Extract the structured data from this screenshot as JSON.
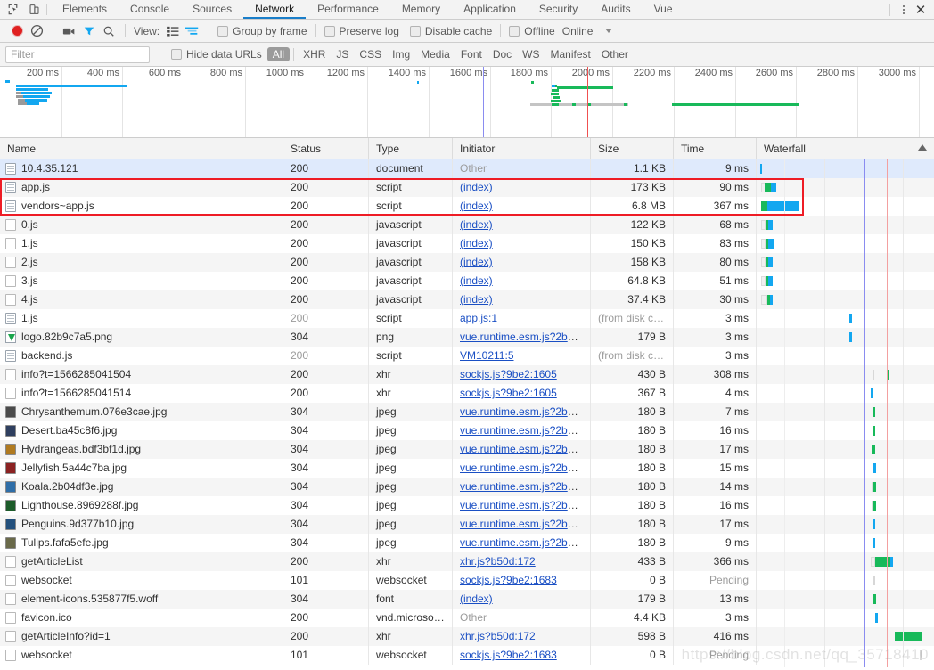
{
  "window": {
    "tabs": [
      {
        "label": "Elements",
        "active": false
      },
      {
        "label": "Console",
        "active": false
      },
      {
        "label": "Sources",
        "active": false
      },
      {
        "label": "Network",
        "active": true
      },
      {
        "label": "Performance",
        "active": false
      },
      {
        "label": "Memory",
        "active": false
      },
      {
        "label": "Application",
        "active": false
      },
      {
        "label": "Security",
        "active": false
      },
      {
        "label": "Audits",
        "active": false
      },
      {
        "label": "Vue",
        "active": false
      }
    ],
    "icons": {
      "inspect": "inspect-element-icon",
      "device": "device-toolbar-icon",
      "more": "more-options-icon",
      "close": "close-devtools-icon"
    }
  },
  "toolbar": {
    "record_label": "record-button",
    "clear_label": "clear-button",
    "capture_screenshots_label": "capture-screenshots-button",
    "filter_label": "filter-toggle-button",
    "search_label": "search-button",
    "view_label": "View:",
    "view_list_label": "list-view-button",
    "view_waterfall_label": "waterfall-view-button",
    "group_by_frame": "Group by frame",
    "preserve_log": "Preserve log",
    "disable_cache": "Disable cache",
    "offline": "Offline",
    "throttling": "Online"
  },
  "filter_bar": {
    "placeholder": "Filter",
    "value": "",
    "hide_data_urls": "Hide data URLs",
    "types": [
      "All",
      "XHR",
      "JS",
      "CSS",
      "Img",
      "Media",
      "Font",
      "Doc",
      "WS",
      "Manifest",
      "Other"
    ],
    "active_type": "All"
  },
  "overview": {
    "ticks": [
      "200 ms",
      "400 ms",
      "600 ms",
      "800 ms",
      "1000 ms",
      "1200 ms",
      "1400 ms",
      "1600 ms",
      "1800 ms",
      "2000 ms",
      "2200 ms",
      "2400 ms",
      "2600 ms",
      "2800 ms",
      "3000 ms"
    ]
  },
  "columns": [
    "Name",
    "Status",
    "Type",
    "Initiator",
    "Size",
    "Time",
    "Waterfall"
  ],
  "requests": [
    {
      "name": "10.4.35.121",
      "icon": "document-file-icon",
      "status": "200",
      "type": "document",
      "initiator": "Other",
      "initiator_link": false,
      "size": "1.1 KB",
      "time": "9 ms",
      "selected": true
    },
    {
      "name": "app.js",
      "icon": "script-file-icon",
      "status": "200",
      "type": "script",
      "initiator": "(index)",
      "initiator_link": true,
      "size": "173 KB",
      "time": "90 ms"
    },
    {
      "name": "vendors~app.js",
      "icon": "script-file-icon",
      "status": "200",
      "type": "script",
      "initiator": "(index)",
      "initiator_link": true,
      "size": "6.8 MB",
      "time": "367 ms"
    },
    {
      "name": "0.js",
      "icon": "generic-file-icon",
      "status": "200",
      "type": "javascript",
      "initiator": "(index)",
      "initiator_link": true,
      "size": "122 KB",
      "time": "68 ms"
    },
    {
      "name": "1.js",
      "icon": "generic-file-icon",
      "status": "200",
      "type": "javascript",
      "initiator": "(index)",
      "initiator_link": true,
      "size": "150 KB",
      "time": "83 ms"
    },
    {
      "name": "2.js",
      "icon": "generic-file-icon",
      "status": "200",
      "type": "javascript",
      "initiator": "(index)",
      "initiator_link": true,
      "size": "158 KB",
      "time": "80 ms"
    },
    {
      "name": "3.js",
      "icon": "generic-file-icon",
      "status": "200",
      "type": "javascript",
      "initiator": "(index)",
      "initiator_link": true,
      "size": "64.8 KB",
      "time": "51 ms"
    },
    {
      "name": "4.js",
      "icon": "generic-file-icon",
      "status": "200",
      "type": "javascript",
      "initiator": "(index)",
      "initiator_link": true,
      "size": "37.4 KB",
      "time": "30 ms"
    },
    {
      "name": "1.js",
      "icon": "script-file-icon",
      "status": "200",
      "type": "script",
      "initiator": "app.js:1",
      "initiator_link": true,
      "size": "(from disk cac...",
      "time": "3 ms",
      "dim": true
    },
    {
      "name": "logo.82b9c7a5.png",
      "icon": "image-file-icon",
      "status": "304",
      "type": "png",
      "initiator": "vue.runtime.esm.js?2b0e:...",
      "initiator_link": true,
      "size": "179 B",
      "time": "3 ms"
    },
    {
      "name": "backend.js",
      "icon": "script-file-icon",
      "status": "200",
      "type": "script",
      "initiator": "VM10211:5",
      "initiator_link": true,
      "size": "(from disk cac...",
      "time": "3 ms",
      "dim": true
    },
    {
      "name": "info?t=1566285041504",
      "icon": "generic-file-icon",
      "status": "200",
      "type": "xhr",
      "initiator": "sockjs.js?9be2:1605",
      "initiator_link": true,
      "size": "430 B",
      "time": "308 ms"
    },
    {
      "name": "info?t=1566285041514",
      "icon": "generic-file-icon",
      "status": "200",
      "type": "xhr",
      "initiator": "sockjs.js?9be2:1605",
      "initiator_link": true,
      "size": "367 B",
      "time": "4 ms"
    },
    {
      "name": "Chrysanthemum.076e3cae.jpg",
      "icon": "image-file-icon",
      "status": "304",
      "type": "jpeg",
      "initiator": "vue.runtime.esm.js?2b0e:...",
      "initiator_link": true,
      "size": "180 B",
      "time": "7 ms"
    },
    {
      "name": "Desert.ba45c8f6.jpg",
      "icon": "image-file-icon",
      "status": "304",
      "type": "jpeg",
      "initiator": "vue.runtime.esm.js?2b0e:...",
      "initiator_link": true,
      "size": "180 B",
      "time": "16 ms"
    },
    {
      "name": "Hydrangeas.bdf3bf1d.jpg",
      "icon": "image-file-icon",
      "status": "304",
      "type": "jpeg",
      "initiator": "vue.runtime.esm.js?2b0e:...",
      "initiator_link": true,
      "size": "180 B",
      "time": "17 ms"
    },
    {
      "name": "Jellyfish.5a44c7ba.jpg",
      "icon": "image-file-icon",
      "status": "304",
      "type": "jpeg",
      "initiator": "vue.runtime.esm.js?2b0e:...",
      "initiator_link": true,
      "size": "180 B",
      "time": "15 ms"
    },
    {
      "name": "Koala.2b04df3e.jpg",
      "icon": "image-file-icon",
      "status": "304",
      "type": "jpeg",
      "initiator": "vue.runtime.esm.js?2b0e:...",
      "initiator_link": true,
      "size": "180 B",
      "time": "14 ms"
    },
    {
      "name": "Lighthouse.8969288f.jpg",
      "icon": "image-file-icon",
      "status": "304",
      "type": "jpeg",
      "initiator": "vue.runtime.esm.js?2b0e:...",
      "initiator_link": true,
      "size": "180 B",
      "time": "16 ms"
    },
    {
      "name": "Penguins.9d377b10.jpg",
      "icon": "image-file-icon",
      "status": "304",
      "type": "jpeg",
      "initiator": "vue.runtime.esm.js?2b0e:...",
      "initiator_link": true,
      "size": "180 B",
      "time": "17 ms"
    },
    {
      "name": "Tulips.fafa5efe.jpg",
      "icon": "image-file-icon",
      "status": "304",
      "type": "jpeg",
      "initiator": "vue.runtime.esm.js?2b0e:...",
      "initiator_link": true,
      "size": "180 B",
      "time": "9 ms"
    },
    {
      "name": "getArticleList",
      "icon": "generic-file-icon",
      "status": "200",
      "type": "xhr",
      "initiator": "xhr.js?b50d:172",
      "initiator_link": true,
      "size": "433 B",
      "time": "366 ms"
    },
    {
      "name": "websocket",
      "icon": "generic-file-icon",
      "status": "101",
      "type": "websocket",
      "initiator": "sockjs.js?9be2:1683",
      "initiator_link": true,
      "size": "0 B",
      "time": "Pending",
      "time_dim": true
    },
    {
      "name": "element-icons.535877f5.woff",
      "icon": "generic-file-icon",
      "status": "304",
      "type": "font",
      "initiator": "(index)",
      "initiator_link": true,
      "size": "179 B",
      "time": "13 ms"
    },
    {
      "name": "favicon.ico",
      "icon": "generic-file-icon",
      "status": "200",
      "type": "vnd.microsoft....",
      "initiator": "Other",
      "initiator_link": false,
      "size": "4.4 KB",
      "time": "3 ms"
    },
    {
      "name": "getArticleInfo?id=1",
      "icon": "generic-file-icon",
      "status": "200",
      "type": "xhr",
      "initiator": "xhr.js?b50d:172",
      "initiator_link": true,
      "size": "598 B",
      "time": "416 ms"
    },
    {
      "name": "websocket",
      "icon": "generic-file-icon",
      "status": "101",
      "type": "websocket",
      "initiator": "sockjs.js?9be2:1683",
      "initiator_link": true,
      "size": "0 B",
      "time": "Pending",
      "time_dim": true
    }
  ],
  "watermark": "https://blog.csdn.net/qq_35718410",
  "colors": {
    "accent": "#1a7ec9",
    "record": "#e02020",
    "download_bar": "#13a7f0",
    "ttfb_bar": "#18b95a",
    "wait_bar": "#d7d7d7",
    "dom_content_loaded": "#0b27f0",
    "load_event": "#f05050",
    "highlight_box": "#ee1c25",
    "selected_row": "#dfeafc"
  }
}
